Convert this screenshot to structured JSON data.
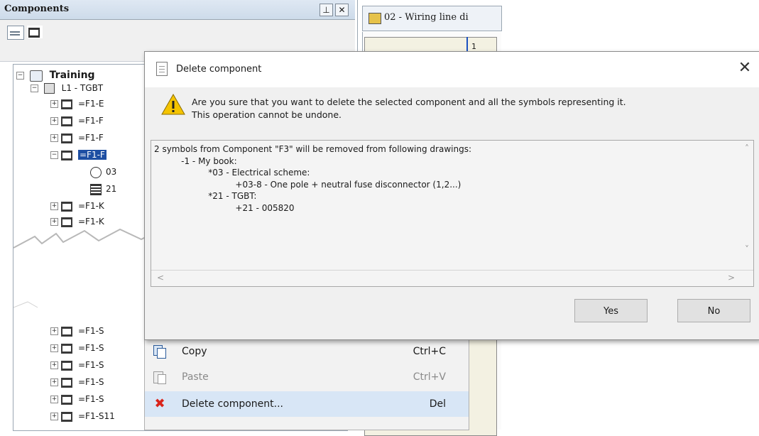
{
  "panel": {
    "title": "Components",
    "pin_glyph": "⊥",
    "close_glyph": "✕",
    "toolbar_icons": [
      "list-view-icon",
      "component-icon"
    ]
  },
  "tree": {
    "root": "Training",
    "l1": "L1 - TGBT",
    "items_top": [
      "=F1-E",
      "=F1-F",
      "=F1-F",
      "=F1-F"
    ],
    "children": [
      "03",
      "21"
    ],
    "items_mid": [
      "=F1-K",
      "=F1-K"
    ],
    "items_bottom": [
      "=F1-S",
      "=F1-S",
      "=F1-S",
      "=F1-S",
      "=F1-S",
      "=F1-S11"
    ]
  },
  "document": {
    "tab_label": "02 - Wiring line di",
    "corner_number": "1"
  },
  "dialog": {
    "title": "Delete component",
    "close": "✕",
    "message_line1": "Are you sure that you want to delete the selected component and all the symbols representing it.",
    "message_line2": "This operation cannot be undone.",
    "details": [
      "2 symbols from Component \"F3\" will be removed from following drawings:",
      "          -1 - My book:",
      "                    *03 - Electrical scheme:",
      "                              +03-8 - One pole + neutral fuse disconnector (1,2...)",
      "                    *21 - TGBT:",
      "                              +21 - 005820"
    ],
    "yes_label": "Yes",
    "no_label": "No",
    "scroll_up": "˄",
    "scroll_down": "˅",
    "scroll_left": "<",
    "scroll_right": ">"
  },
  "context_menu": {
    "items": [
      {
        "label": "Copy",
        "shortcut": "Ctrl+C",
        "icon": "copy-icon"
      },
      {
        "label": "Paste",
        "shortcut": "Ctrl+V",
        "icon": "paste-icon"
      },
      {
        "label": "Delete component...",
        "shortcut": "Del",
        "icon": "delete-x-icon"
      }
    ]
  },
  "colors": {
    "selection": "#1e4fa3",
    "delete_icon": "#d9241b",
    "warning": "#f5c400"
  }
}
